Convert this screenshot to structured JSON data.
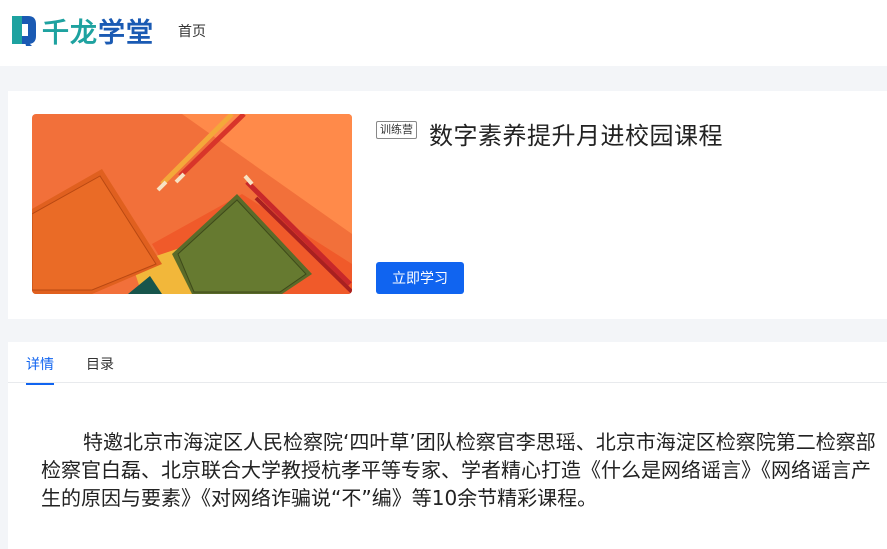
{
  "header": {
    "logo_text_part1": "千龙",
    "logo_text_part2": "学堂",
    "nav_home": "首页"
  },
  "course": {
    "tag": "训练营",
    "title": "数字素养提升月进校园课程",
    "study_button": "立即学习"
  },
  "tabs": [
    {
      "label": "详情",
      "active": true
    },
    {
      "label": "目录",
      "active": false
    }
  ],
  "detail": {
    "description": "特邀北京市海淀区人民检察院‘四叶草’团队检察官李思瑶、北京市海淀区检察院第二检察部检察官白磊、北京联合大学教授杭孝平等专家、学者精心打造《什么是网络谣言》《网络谣言产生的原因与要素》《对网络诈骗说“不”编》等10余节精彩课程。"
  },
  "colors": {
    "accent": "#1064f0",
    "logo_teal": "#1ea2a0",
    "logo_blue": "#1a5ab3"
  }
}
